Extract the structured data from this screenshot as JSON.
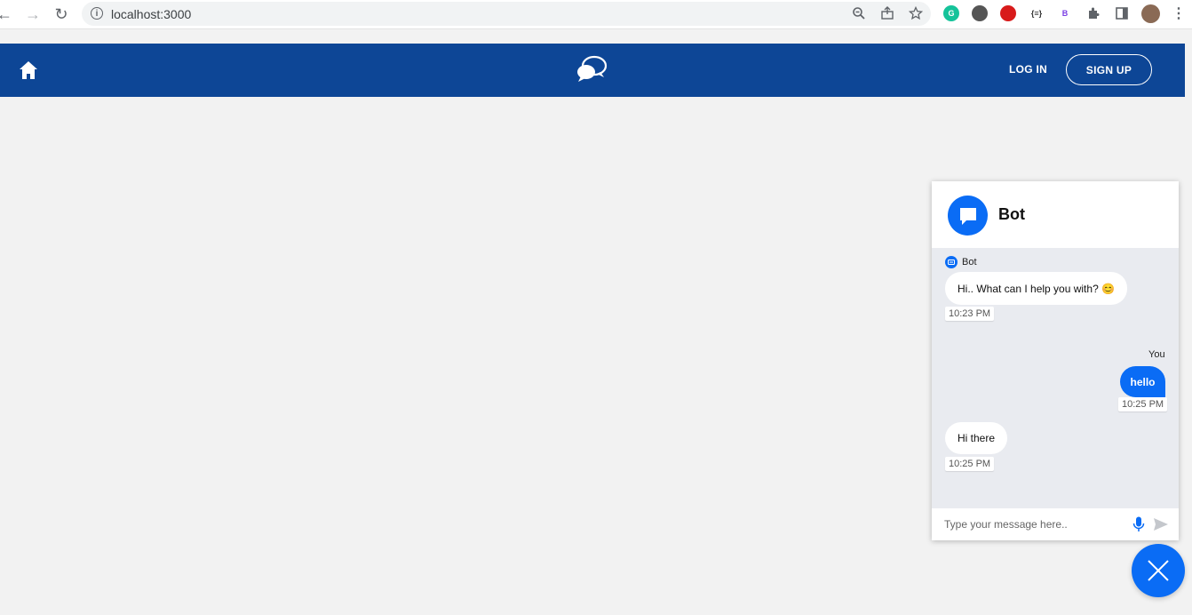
{
  "browser": {
    "url": "localhost:3000"
  },
  "navbar": {
    "login_label": "LOG IN",
    "signup_label": "SIGN UP",
    "bg_color": "#0d4696"
  },
  "chat": {
    "bot_name": "Bot",
    "accent_color": "#0a6cf5",
    "messages": [
      {
        "sender": "Bot",
        "text": "Hi.. What can I help you with? 😊",
        "time": "10:23 PM"
      },
      {
        "sender": "You",
        "text": "hello",
        "time": "10:25 PM"
      },
      {
        "sender": "Bot",
        "text": "Hi there",
        "time": "10:25 PM"
      }
    ],
    "input_placeholder": "Type your message here.."
  }
}
